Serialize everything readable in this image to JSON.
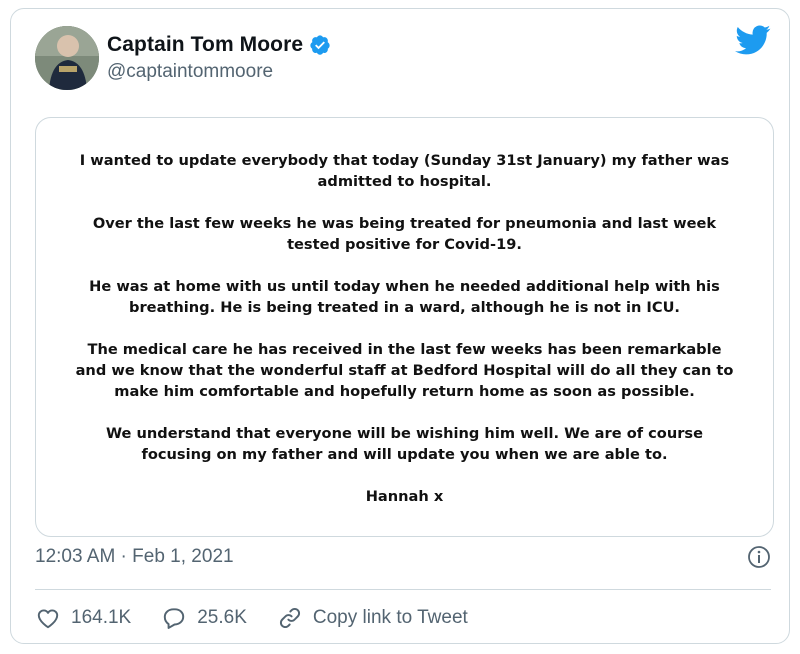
{
  "author": {
    "display_name": "Captain Tom Moore",
    "handle": "@captaintommoore",
    "verified": true
  },
  "statement": {
    "paragraphs": [
      "I wanted to update everybody that today (Sunday 31st January) my father was admitted to hospital.",
      "Over the last few weeks he was being treated for pneumonia and last week tested positive for Covid-19.",
      "He was at home with us until today when he needed additional help with his breathing. He is being treated in a ward, although he is not in ICU.",
      "The medical care he has received in the last few weeks has been remarkable and we know that the wonderful staff at Bedford Hospital will do all they can to make him comfortable and hopefully return home as soon as possible.",
      "We understand that everyone will be wishing him well. We are of course focusing on my father and will update you when we are able to.",
      "Hannah x"
    ]
  },
  "meta": {
    "timestamp": "12:03 AM · Feb 1, 2021"
  },
  "actions": {
    "likes": "164.1K",
    "replies": "25.6K",
    "copy_link": "Copy link to Tweet"
  },
  "icons": {
    "like": "heart-icon",
    "reply": "speech-bubble-icon",
    "copy": "link-icon",
    "info": "info-icon",
    "brand": "twitter-bird-icon",
    "verified": "verified-badge-icon"
  },
  "colors": {
    "twitter_blue": "#1d9bf0",
    "secondary_text": "#536471",
    "border": "#cfd9de"
  }
}
